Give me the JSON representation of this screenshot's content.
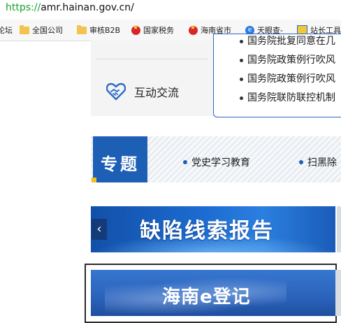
{
  "browser": {
    "url_scheme": "https://",
    "url_host": "amr.hainan.gov.cn/",
    "bookmarks": [
      {
        "label": "论坛",
        "icon": "folder-icon"
      },
      {
        "label": "全国公司",
        "icon": "folder-icon"
      },
      {
        "label": "审核B2B",
        "icon": "folder-icon"
      },
      {
        "label": "国家税务",
        "icon": "emblem-icon"
      },
      {
        "label": "海南省市",
        "icon": "emblem-icon"
      },
      {
        "label": "天眼查-",
        "icon": "tianyancha-icon"
      },
      {
        "label": "站长工具",
        "icon": "toolbox-icon"
      }
    ]
  },
  "sidebar": {
    "interact_label": "互动交流",
    "interact_icon": "handshake-heart-icon"
  },
  "news": {
    "items": [
      "国务院批复同意在几",
      "国务院政策例行吹风",
      "国务院政策例行吹风",
      "国务院联防联控机制"
    ]
  },
  "topic": {
    "title": "专题",
    "links": [
      "党史学习教育",
      "扫黑除"
    ]
  },
  "banners": {
    "defect_report": "缺陷线索报告",
    "prev_arrow": "‹",
    "e_register": "海南e登记"
  },
  "colors": {
    "accent_blue": "#1e5fb6",
    "url_green": "#17a42b",
    "corner_yellow": "#f6c21a"
  }
}
